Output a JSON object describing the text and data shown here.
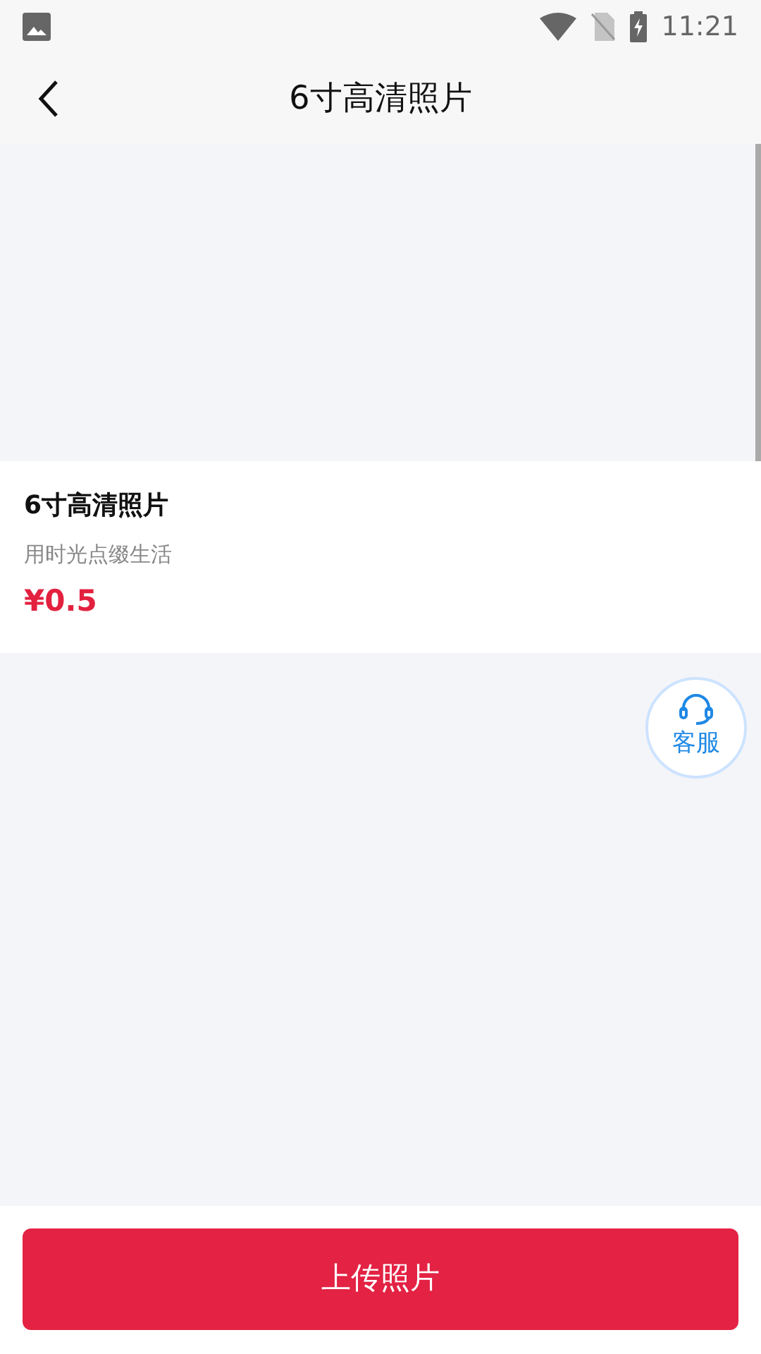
{
  "status_bar": {
    "time": "11:21"
  },
  "header": {
    "title": "6寸高清照片"
  },
  "product": {
    "name": "6寸高清照片",
    "subtitle": "用时光点缀生活",
    "price": "¥0.5"
  },
  "service_button": {
    "label": "客服"
  },
  "upload_button": {
    "label": "上传照片"
  }
}
